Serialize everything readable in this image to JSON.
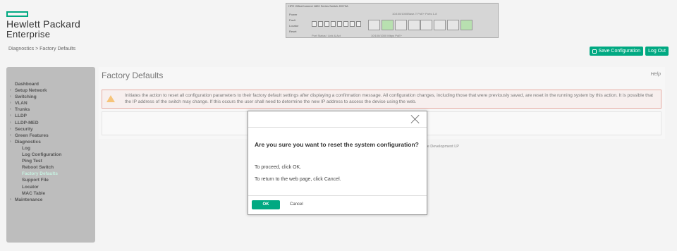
{
  "brand": {
    "line1": "Hewlett Packard",
    "line2": "Enterprise",
    "accent": "#01a982"
  },
  "breadcrumb": "Diagnostics > Factory Defaults",
  "device": {
    "title": "HPE OfficeConnect 1820 Series Switch J9979A",
    "status_labels": [
      "Power",
      "Fault",
      "Locator",
      "Reset"
    ],
    "port_caption": "10/100/1000Base-T PoE+ Ports 1-8",
    "left_caption": "Port Status / Link & Act",
    "right_caption": "10/100/1000 Mbps PoE+"
  },
  "toolbar": {
    "save_label": "Save Configuration",
    "logout_label": "Log Out"
  },
  "sidebar": {
    "items": [
      {
        "label": "Dashboard",
        "arrow": false,
        "sub": false
      },
      {
        "label": "Setup Network",
        "arrow": true,
        "sub": false
      },
      {
        "label": "Switching",
        "arrow": true,
        "sub": false
      },
      {
        "label": "VLAN",
        "arrow": true,
        "sub": false
      },
      {
        "label": "Trunks",
        "arrow": true,
        "sub": false
      },
      {
        "label": "LLDP",
        "arrow": true,
        "sub": false
      },
      {
        "label": "LLDP-MED",
        "arrow": true,
        "sub": false
      },
      {
        "label": "Security",
        "arrow": true,
        "sub": false
      },
      {
        "label": "Green Features",
        "arrow": true,
        "sub": false
      },
      {
        "label": "Diagnostics",
        "arrow": true,
        "sub": false
      },
      {
        "label": "Log",
        "arrow": false,
        "sub": true
      },
      {
        "label": "Log Configuration",
        "arrow": false,
        "sub": true
      },
      {
        "label": "Ping Test",
        "arrow": false,
        "sub": true
      },
      {
        "label": "Reboot Switch",
        "arrow": false,
        "sub": true
      },
      {
        "label": "Factory Defaults",
        "arrow": false,
        "sub": true,
        "active": true
      },
      {
        "label": "Support File",
        "arrow": false,
        "sub": true
      },
      {
        "label": "Locator",
        "arrow": false,
        "sub": true
      },
      {
        "label": "MAC Table",
        "arrow": false,
        "sub": true
      },
      {
        "label": "Maintenance",
        "arrow": true,
        "sub": false
      }
    ]
  },
  "main": {
    "title": "Factory Defaults",
    "help": "Help",
    "warning": "Initiates the action to reset all configuration parameters to their factory default settings after displaying a confirmation message. All configuration changes, including those that were previously saved, are reset in the running system by this action. It is possible that the IP address of the switch may change. If this occurs the user shall need to determine the new IP address to access the device using the web.",
    "copyright": "rprise Development LP"
  },
  "dialog": {
    "question": "Are you sure you want to reset the system configuration?",
    "line1": "To proceed, click OK.",
    "line2": "To return to the web page, click Cancel.",
    "ok_label": "OK",
    "cancel_label": "Cancel"
  }
}
